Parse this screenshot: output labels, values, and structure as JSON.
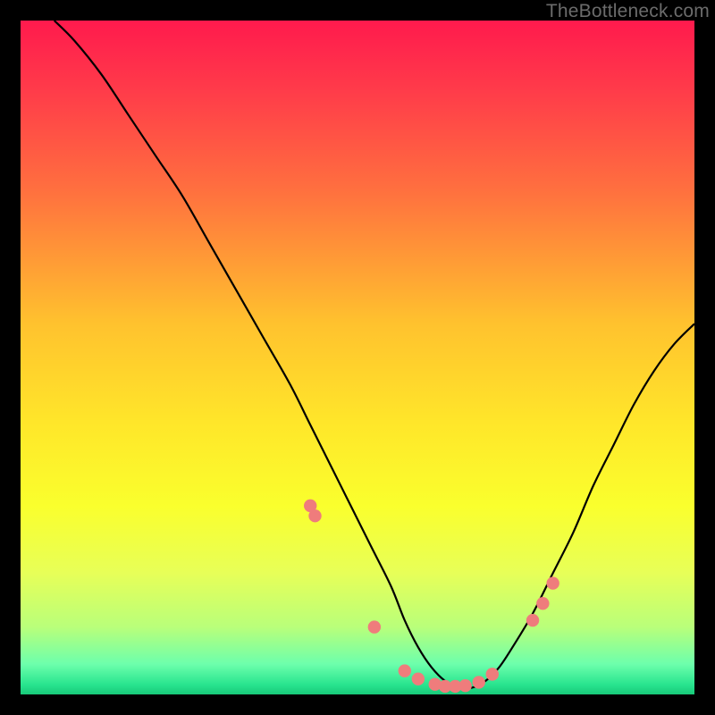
{
  "watermark": "TheBottleneck.com",
  "colors": {
    "bg": "#000000",
    "curve": "#000000",
    "marker_fill": "#ef7c7c",
    "marker_stroke": "#d85f5f",
    "gradient_stops": [
      {
        "offset": 0.0,
        "color": "#ff1a4d"
      },
      {
        "offset": 0.1,
        "color": "#ff3a4a"
      },
      {
        "offset": 0.25,
        "color": "#ff6f3f"
      },
      {
        "offset": 0.45,
        "color": "#ffc22e"
      },
      {
        "offset": 0.6,
        "color": "#ffe72a"
      },
      {
        "offset": 0.72,
        "color": "#faff2d"
      },
      {
        "offset": 0.82,
        "color": "#e7ff58"
      },
      {
        "offset": 0.9,
        "color": "#b9ff7a"
      },
      {
        "offset": 0.955,
        "color": "#6dffac"
      },
      {
        "offset": 0.985,
        "color": "#29e58f"
      },
      {
        "offset": 1.0,
        "color": "#18c979"
      }
    ]
  },
  "chart_data": {
    "type": "line",
    "title": "",
    "xlabel": "",
    "ylabel": "",
    "xlim": [
      0,
      100
    ],
    "ylim": [
      0,
      100
    ],
    "series": [
      {
        "name": "bottleneck-curve",
        "x": [
          5,
          8,
          12,
          16,
          20,
          24,
          28,
          32,
          36,
          40,
          43,
          46,
          49,
          52,
          55,
          57,
          59,
          61,
          63,
          65,
          67,
          69,
          71,
          73,
          76,
          79,
          82,
          85,
          88,
          91,
          94,
          97,
          100
        ],
        "y": [
          100,
          97,
          92,
          86,
          80,
          74,
          67,
          60,
          53,
          46,
          40,
          34,
          28,
          22,
          16,
          11,
          7,
          4,
          2,
          1,
          1,
          2,
          4,
          7,
          12,
          18,
          24,
          31,
          37,
          43,
          48,
          52,
          55
        ]
      }
    ],
    "markers": {
      "name": "highlighted-points",
      "x": [
        43.0,
        43.7,
        52.5,
        57.0,
        59.0,
        61.5,
        63.0,
        64.5,
        66.0,
        68.0,
        70.0,
        76.0,
        77.5,
        79.0
      ],
      "y": [
        28.0,
        26.5,
        10.0,
        3.5,
        2.3,
        1.5,
        1.2,
        1.2,
        1.3,
        1.8,
        3.0,
        11.0,
        13.5,
        16.5
      ]
    }
  }
}
